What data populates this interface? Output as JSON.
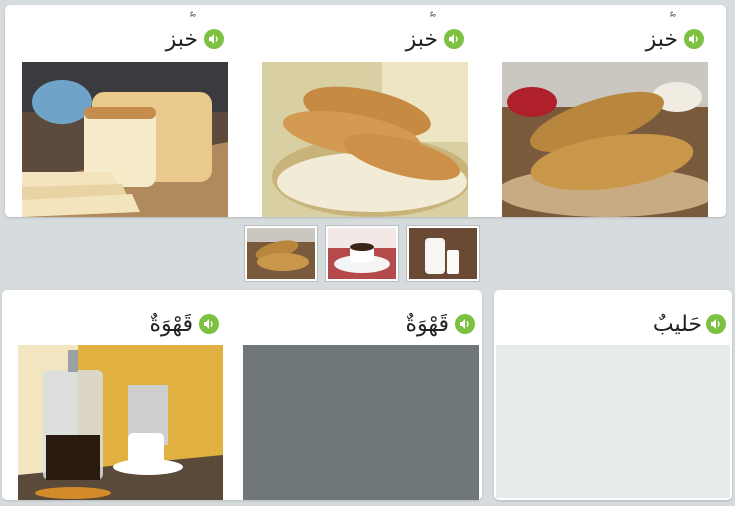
{
  "top_row": {
    "cards": [
      {
        "word": "خبز",
        "marks": "ٌ ّ ْ",
        "audio": "speaker-icon",
        "photo": "bread-loaf-on-board"
      },
      {
        "word": "خبز",
        "marks": "ٌ ّ ْ",
        "audio": "speaker-icon",
        "photo": "bread-in-basket"
      },
      {
        "word": "خبز",
        "marks": "ٌ ّ ْ",
        "audio": "speaker-icon",
        "photo": "baguettes-on-plate"
      }
    ]
  },
  "choices": [
    {
      "photo": "bread-thumbnail"
    },
    {
      "photo": "coffee-cup-thumbnail"
    },
    {
      "photo": "milk-thumbnail"
    }
  ],
  "bottom_row": {
    "cards": [
      {
        "word": "قَهْوَةٌ",
        "audio": "speaker-icon",
        "photo": "french-press-coffee"
      },
      {
        "word": "قَهْوَةٌ",
        "audio": "speaker-icon",
        "photo": "empty-slot"
      },
      {
        "word": "حَليبٌ",
        "audio": "speaker-icon",
        "photo": "empty-slot"
      }
    ]
  },
  "colors": {
    "background": "#d6dbde",
    "speaker": "#7cc142",
    "empty_slot_dark": "#70777b",
    "empty_slot_light": "#e8ebec"
  }
}
